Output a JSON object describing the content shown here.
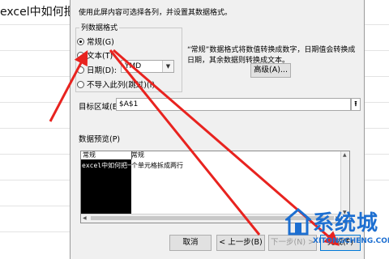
{
  "spreadsheet": {
    "cell_text": "excel中如何把"
  },
  "dialog": {
    "hint": "使用此屏内容可选择各列，并设置其数据格式。",
    "column_format": {
      "title": "列数据格式",
      "options": [
        {
          "label": "常规(G)",
          "selected": true
        },
        {
          "label": "文本(T)",
          "selected": false
        },
        {
          "label": "日期(D):",
          "selected": false
        },
        {
          "label": "不导入此列(跳过)(I)",
          "selected": false
        }
      ],
      "date_value": "YMD"
    },
    "description": "“常规”数据格式将数值转换成数字，日期值会转换成日期，其余数据则转换成文本。",
    "advanced_button": "高级(A)...",
    "destination": {
      "label": "目标区域(E):",
      "value": "$A$1"
    },
    "preview": {
      "label": "数据预览(P)",
      "headers": [
        "常规",
        "常规"
      ],
      "cell1": "excel中如何把一",
      "cell2": "个单元格拆成两行"
    },
    "buttons": {
      "cancel": "取消",
      "back": "< 上一步(B)",
      "next": "下一步(N) >",
      "finish": "完成(F)"
    }
  },
  "watermark": {
    "text": "系统城",
    "url": "XITONGCHENG.COM"
  },
  "colors": {
    "arrow": "#e8231f",
    "watermark": "#1d6fd1",
    "focus": "#0078d7"
  }
}
